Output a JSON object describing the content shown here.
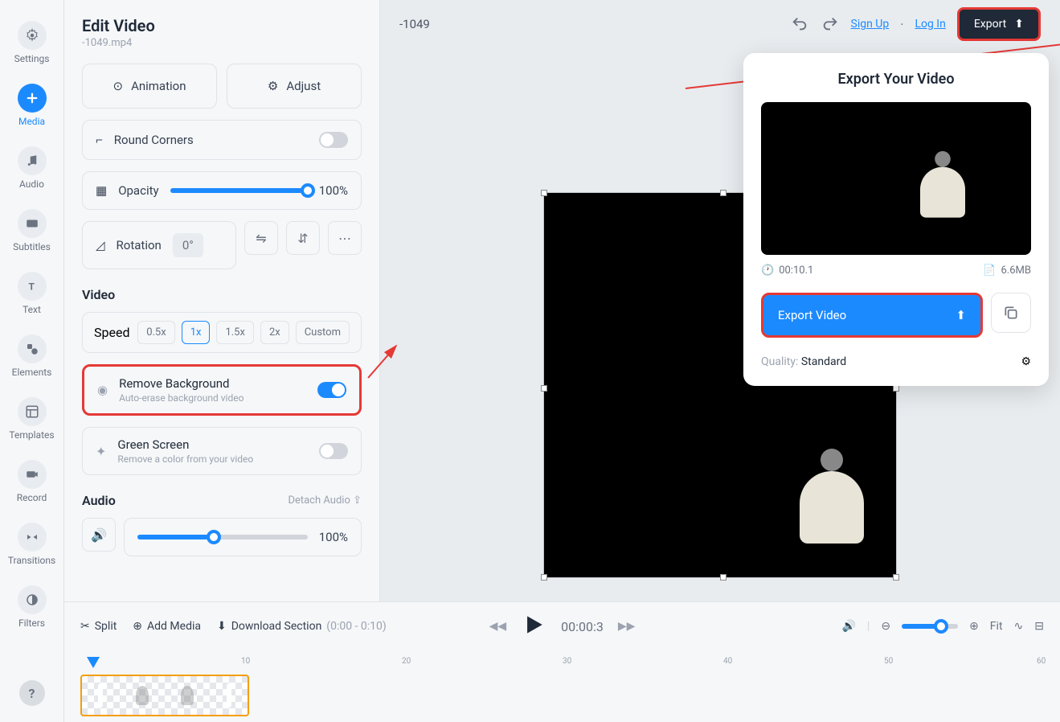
{
  "sidebar": {
    "items": [
      {
        "label": "Settings"
      },
      {
        "label": "Media"
      },
      {
        "label": "Audio"
      },
      {
        "label": "Subtitles"
      },
      {
        "label": "Text"
      },
      {
        "label": "Elements"
      },
      {
        "label": "Templates"
      },
      {
        "label": "Record"
      },
      {
        "label": "Transitions"
      },
      {
        "label": "Filters"
      }
    ],
    "help": "?"
  },
  "panel": {
    "title": "Edit Video",
    "filename": "-1049.mp4",
    "animation_btn": "Animation",
    "adjust_btn": "Adjust",
    "round_corners": "Round Corners",
    "opacity_label": "Opacity",
    "opacity_value": "100%",
    "rotation_label": "Rotation",
    "rotation_value": "0°",
    "video_section": "Video",
    "speed_label": "Speed",
    "speed_options": [
      "0.5x",
      "1x",
      "1.5x",
      "2x",
      "Custom"
    ],
    "remove_bg_title": "Remove Background",
    "remove_bg_sub": "Auto-erase background video",
    "green_screen_title": "Green Screen",
    "green_screen_sub": "Remove a color from your video",
    "audio_section": "Audio",
    "detach_audio": "Detach Audio",
    "audio_value": "100%"
  },
  "topbar": {
    "project_name": "-1049",
    "signup": "Sign Up",
    "login": "Log In",
    "export": "Export"
  },
  "popup": {
    "title": "Export Your Video",
    "duration": "00:10.1",
    "filesize": "6.6MB",
    "export_btn": "Export Video",
    "quality_label": "Quality:",
    "quality_value": "Standard"
  },
  "bottom": {
    "split": "Split",
    "add_media": "Add Media",
    "download_section": "Download Section",
    "download_range": "(0:00 - 0:10)",
    "current_time": "00:00:3",
    "fit": "Fit",
    "ruler_marks": [
      "10",
      "20",
      "30",
      "40",
      "50",
      "60"
    ]
  }
}
